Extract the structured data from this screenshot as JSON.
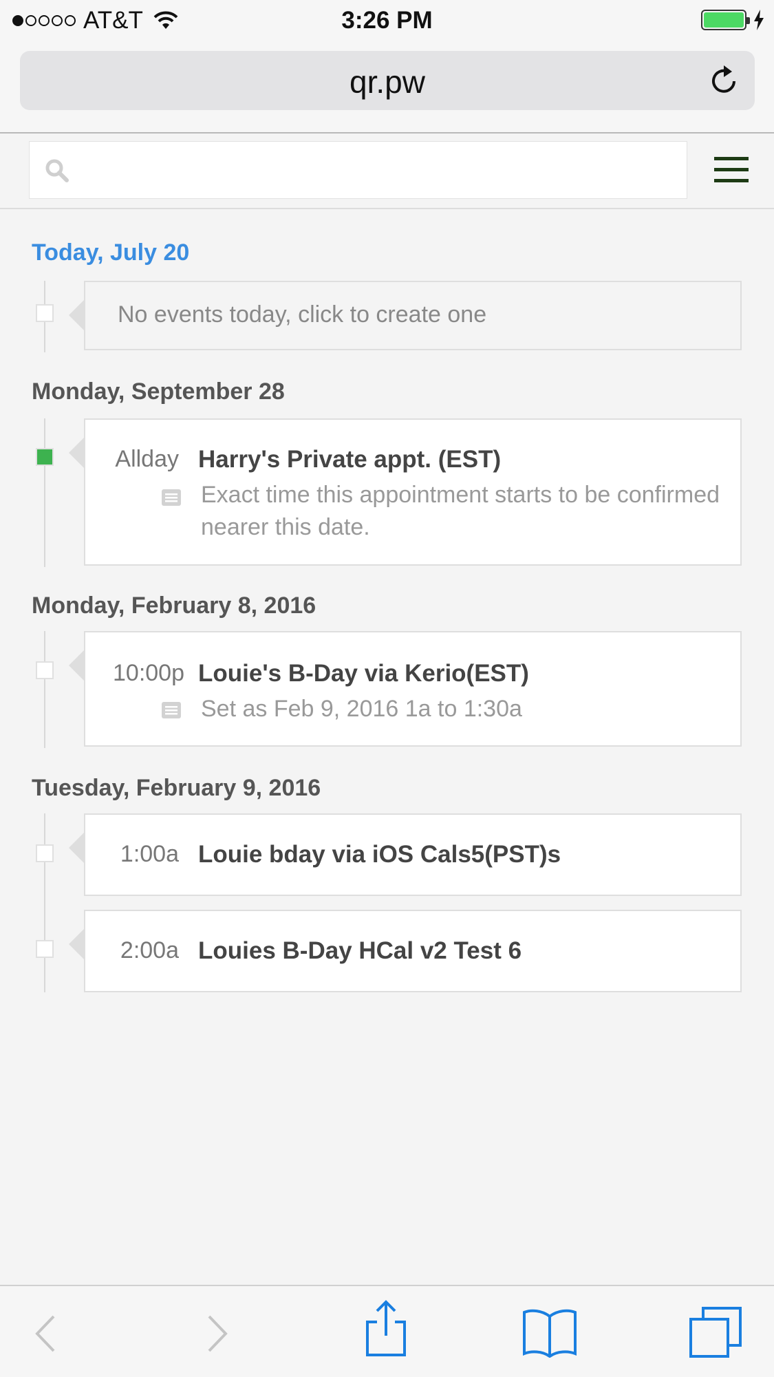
{
  "status_bar": {
    "carrier": "AT&T",
    "time": "3:26 PM",
    "signal_bars_filled": 1,
    "signal_bars_total": 5,
    "battery_level": 1.0,
    "battery_color": "#4cd964",
    "charging": true
  },
  "browser": {
    "url": "qr.pw",
    "reload_icon": "reload-icon"
  },
  "search": {
    "placeholder": "",
    "icon": "search-icon",
    "menu_icon": "hamburger-menu-icon"
  },
  "agenda": [
    {
      "heading": "Today, July 20",
      "is_today": true,
      "events": [
        {
          "empty": true,
          "text": "No events today, click to create one"
        }
      ]
    },
    {
      "heading": "Monday, September 28",
      "events": [
        {
          "time": "Allday",
          "title": "Harry's Private appt. (EST)",
          "note": "Exact time this appointment starts to be confirmed nearer this date.",
          "marker_color": "#3db24f"
        }
      ]
    },
    {
      "heading": "Monday, February 8, 2016",
      "events": [
        {
          "time": "10:00p",
          "title": "Louie's B-Day via Kerio(EST)",
          "note": "Set as Feb 9, 2016 1a to 1:30a"
        }
      ]
    },
    {
      "heading": "Tuesday, February 9, 2016",
      "events": [
        {
          "time": "1:00a",
          "title": "Louie bday via iOS Cals5(PST)s"
        },
        {
          "time": "2:00a",
          "title": "Louies B-Day HCal v2 Test 6"
        }
      ]
    }
  ],
  "toolbar": {
    "back_icon": "back-chevron-icon",
    "forward_icon": "forward-chevron-icon",
    "share_icon": "share-icon",
    "bookmarks_icon": "bookmarks-icon",
    "tabs_icon": "tabs-icon",
    "accent": "#1a7fe0",
    "disabled": "#c4c4c4"
  }
}
